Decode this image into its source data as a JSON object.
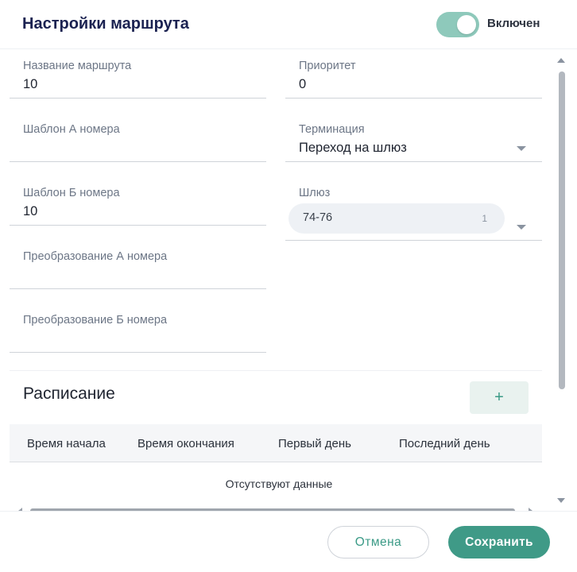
{
  "header": {
    "title": "Настройки маршрута",
    "toggle": {
      "label": "Включен",
      "on": true
    }
  },
  "form": {
    "route_name": {
      "label": "Название маршрута",
      "value": "10"
    },
    "priority": {
      "label": "Приоритет",
      "value": "0"
    },
    "a_template": {
      "label": "Шаблон А номера",
      "value": ""
    },
    "termination": {
      "label": "Терминация",
      "value": "Переход на шлюз"
    },
    "b_template": {
      "label": "Шаблон Б номера",
      "value": "10"
    },
    "gateway": {
      "label": "Шлюз",
      "chip": "74-76",
      "chip_count": "1"
    },
    "a_transform": {
      "label": "Преобразование А номера",
      "value": ""
    },
    "b_transform": {
      "label": "Преобразование Б номера",
      "value": ""
    }
  },
  "schedule": {
    "title": "Расписание",
    "add_label": "+",
    "columns": [
      "Время начала",
      "Время окончания",
      "Первый день",
      "Последний день"
    ],
    "empty_text": "Отсутствуют данные"
  },
  "footer": {
    "cancel_label": "Отмена",
    "save_label": "Сохранить"
  },
  "colors": {
    "accent": "#3f9a87",
    "toggle_on": "#8ec9bb",
    "title": "#1b2251"
  }
}
